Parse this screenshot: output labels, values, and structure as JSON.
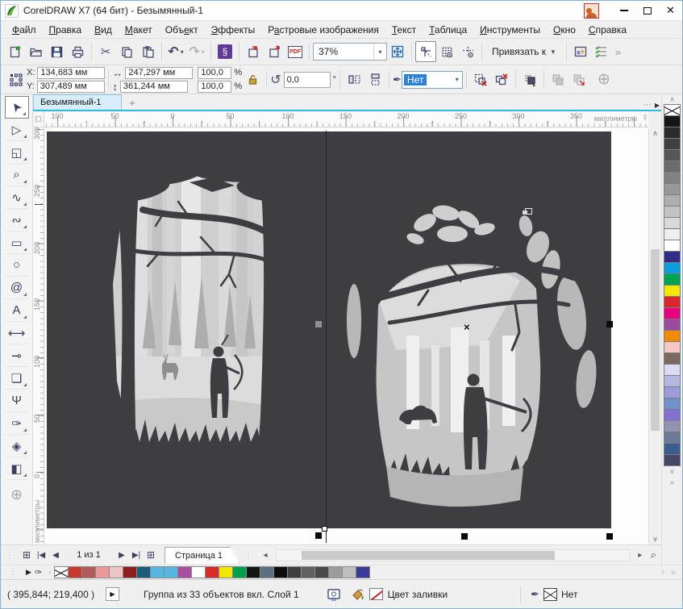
{
  "window": {
    "title": "CorelDRAW X7 (64 бит) - Безымянный-1",
    "close_glyph": "✕"
  },
  "menu": {
    "items": [
      {
        "pre": "",
        "key": "Ф",
        "post": "айл"
      },
      {
        "pre": "",
        "key": "П",
        "post": "равка"
      },
      {
        "pre": "",
        "key": "В",
        "post": "ид"
      },
      {
        "pre": "",
        "key": "М",
        "post": "акет"
      },
      {
        "pre": "Объ",
        "key": "е",
        "post": "кт"
      },
      {
        "pre": "",
        "key": "Э",
        "post": "ффекты"
      },
      {
        "pre": "Р",
        "key": "а",
        "post": "стровые изображения"
      },
      {
        "pre": "",
        "key": "Т",
        "post": "екст"
      },
      {
        "pre": "",
        "key": "Т",
        "post": "аблица"
      },
      {
        "pre": "",
        "key": "И",
        "post": "нструменты"
      },
      {
        "pre": "",
        "key": "О",
        "post": "кно"
      },
      {
        "pre": "",
        "key": "С",
        "post": "правка"
      }
    ]
  },
  "toolbar": {
    "zoom_value": "37%",
    "snap_label": "Привязать к",
    "pdf_label": "PDF",
    "overflow": "»"
  },
  "property_bar": {
    "x_label": "X:",
    "y_label": "Y:",
    "x_value": "134,683 мм",
    "y_value": "307,489 мм",
    "w_value": "247,297 мм",
    "h_value": "361,244 мм",
    "scale_x": "100,0",
    "scale_y": "100,0",
    "pct": "%",
    "angle": "0,0",
    "deg": "°",
    "outline_width": "Нет"
  },
  "tabs": {
    "active": "Безымянный-1",
    "new_tab": "+",
    "overflow": "⋯",
    "scroll": "▶"
  },
  "rulers": {
    "h_labels": [
      "100",
      "50",
      "0",
      "50",
      "100",
      "150",
      "200",
      "250",
      "300",
      "350"
    ],
    "v_labels": [
      "300",
      "250",
      "200",
      "150",
      "100",
      "50",
      "0"
    ],
    "unit": "миллиметры"
  },
  "toolbox": {
    "tools": [
      {
        "name": "pick-tool",
        "glyph": "➤"
      },
      {
        "name": "shape-tool",
        "glyph": "▷"
      },
      {
        "name": "crop-tool",
        "glyph": "◱"
      },
      {
        "name": "zoom-tool",
        "glyph": "⌕"
      },
      {
        "name": "freehand-tool",
        "glyph": "∿"
      },
      {
        "name": "bezier-tool",
        "glyph": "∾"
      },
      {
        "name": "rectangle-tool",
        "glyph": "▭"
      },
      {
        "name": "ellipse-tool",
        "glyph": "○"
      },
      {
        "name": "polygon-tool",
        "glyph": "@"
      },
      {
        "name": "text-tool",
        "glyph": "А"
      },
      {
        "name": "dimension-tool",
        "glyph": "⟷"
      },
      {
        "name": "connector-tool",
        "glyph": "⊸"
      },
      {
        "name": "shadow-tool",
        "glyph": "❏"
      },
      {
        "name": "transparency-tool",
        "glyph": "Ψ"
      },
      {
        "name": "eyedropper-tool",
        "glyph": "✑"
      },
      {
        "name": "fill-tool",
        "glyph": "◈"
      },
      {
        "name": "smartfill-tool",
        "glyph": "◧"
      },
      {
        "name": "add-tools-button",
        "glyph": "⊕"
      }
    ]
  },
  "canvas": {
    "center_mark": "×"
  },
  "page_nav": {
    "page_indicator": "1 из 1",
    "page_tab": "Страница 1",
    "first": "|◀",
    "prev": "◀",
    "next": "▶",
    "last": "▶|",
    "add_page": "⊞"
  },
  "doc_palette": {
    "colors": [
      "none",
      "#c8392f",
      "#b15a5a",
      "#e9999b",
      "#edc6c4",
      "#8e1e1e",
      "#1b5e7b",
      "#55b7e0",
      "#55b7e0",
      "#a74f9e",
      "#ffffff",
      "#d92b27",
      "#f3e600",
      "#00a14e",
      "#141414",
      "#5d6e80",
      "#0d0d0d",
      "#3f3f3f",
      "#606060",
      "#4a4a4a",
      "#9b9b9b",
      "#bfbfbf",
      "#3b3a9b"
    ]
  },
  "right_palette": {
    "colors": [
      "none",
      "#141414",
      "#2a2a2a",
      "#404040",
      "#565656",
      "#6c6c6c",
      "#828282",
      "#989898",
      "#aeaeae",
      "#c4c4c4",
      "#dadada",
      "#efefef",
      "#ffffff",
      "#2e2d87",
      "#0c9ddf",
      "#00a44f",
      "#f3e600",
      "#d8262c",
      "#e5017d",
      "#9c4a9b",
      "#f28b00",
      "#f8c7c7",
      "#7a695f",
      "#dbdbf2",
      "#b6b6e2",
      "#9c9cdc",
      "#7191cb",
      "#8271d1",
      "#9292b2",
      "#6a7a99",
      "#3c5c8d",
      "#474769"
    ]
  },
  "status_bar": {
    "coords": "( 395,844; 219,400 )",
    "object_info": "Группа из 33 объектов вкл. Слой 1",
    "fill_label": "Цвет заливки",
    "outline_value": "Нет"
  },
  "colors": {
    "accent": "#35b4ea",
    "pasteboard": "#3e3d41"
  }
}
